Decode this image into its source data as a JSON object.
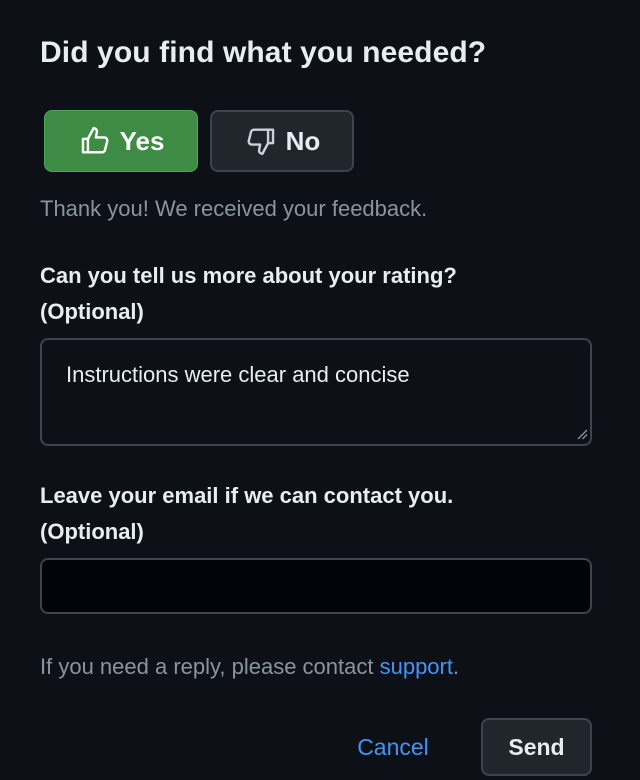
{
  "feedback": {
    "title": "Did you find what you needed?",
    "yes_label": "Yes",
    "no_label": "No",
    "selected_vote": "yes",
    "thanks_message": "Thank you! We received your feedback.",
    "more_label_line1": "Can you tell us more about your rating?",
    "more_label_line2": "(Optional)",
    "more_value": "Instructions were clear and concise",
    "email_label_line1": "Leave your email if we can contact you.",
    "email_label_line2": "(Optional)",
    "email_value": "",
    "reply_note_prefix": "If you need a reply, please contact ",
    "support_link_text": "support",
    "reply_note_suffix": ".",
    "cancel_label": "Cancel",
    "send_label": "Send"
  },
  "icons": {
    "yes": "thumbs-up-icon",
    "no": "thumbs-down-icon",
    "resize": "resize-grip-icon"
  },
  "colors": {
    "background": "#0d1117",
    "yes_button": "#3d8b44",
    "link": "#4493f8",
    "muted_text": "#8b949e"
  }
}
